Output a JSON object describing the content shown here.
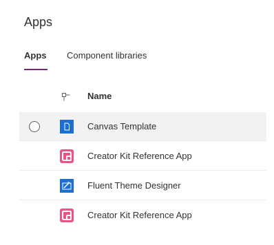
{
  "page": {
    "title": "Apps"
  },
  "tabs": [
    {
      "label": "Apps",
      "active": true
    },
    {
      "label": "Component libraries",
      "active": false
    }
  ],
  "grid": {
    "columns": {
      "type_icon": "app-type-column-icon",
      "name": "Name"
    },
    "rows": [
      {
        "name": "Canvas Template",
        "icon": "canvas-app-icon",
        "icon_color": "#1B6FD1",
        "selected": true
      },
      {
        "name": "Creator Kit Reference App",
        "icon": "creator-kit-app-icon",
        "icon_color": "#E8548A",
        "selected": false
      },
      {
        "name": "Fluent Theme Designer",
        "icon": "fluent-theme-designer-app-icon",
        "icon_color": "#1B6FD1",
        "selected": false
      },
      {
        "name": "Creator Kit Reference App",
        "icon": "creator-kit-app-icon",
        "icon_color": "#E8548A",
        "selected": false
      }
    ]
  },
  "colors": {
    "accent": "#742774",
    "text": "#323130",
    "row_hover": "#F3F2F1",
    "divider": "#EDEBE9"
  }
}
